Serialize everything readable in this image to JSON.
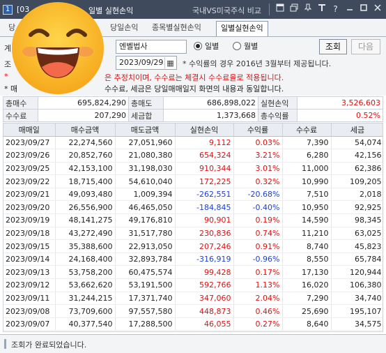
{
  "window": {
    "number": "1",
    "title_prefix": "[03",
    "title_suffix": "일별 실현손익",
    "title_link": "국내VS미국주식 비교",
    "icons": [
      "window-icon",
      "restore-icon",
      "pin-icon",
      "font-icon",
      "help-icon",
      "minimize-icon",
      "maximize-icon",
      "close-icon"
    ]
  },
  "tabs": [
    {
      "label": "당"
    },
    {
      "label": "당일손익"
    },
    {
      "label": "종목별실현손익"
    },
    {
      "label": "일별실현손익",
      "active": true
    }
  ],
  "controls": {
    "account_prefix": "계",
    "account_name": "엔벨법사",
    "query_prefix": "조",
    "date": "2023/09/29",
    "return_note": "* 수익률의 경우 2016년 3월부터 제공됩니다.",
    "radio_daily": "일별",
    "radio_monthly": "월별",
    "btn_query": "조회",
    "btn_next": "다음",
    "red_note_prefix": "*",
    "red_note": "은 추정치이며, 수수료는 체결시 수수료율로 적용됩니다.",
    "black_note_prefix": "* 매",
    "black_note": "수수료, 세금은 당일매매일지 화면의 내용과 동일합니다."
  },
  "summary": {
    "row1": [
      {
        "label": "총매수",
        "value": "695,824,290"
      },
      {
        "label": "총매도",
        "value": "686,898,022"
      },
      {
        "label": "실현손익",
        "value": "3,526,603",
        "color": "#e01010"
      }
    ],
    "row2": [
      {
        "label": "수수료",
        "value": "207,290"
      },
      {
        "label": "세금합",
        "value": "1,373,668"
      },
      {
        "label": "총수익률",
        "value": "0.52%",
        "color": "#e01010"
      }
    ]
  },
  "table": {
    "headers": [
      "매매일",
      "매수금액",
      "매도금액",
      "실현손익",
      "수익률",
      "수수료",
      "세금"
    ],
    "rows": [
      [
        "2023/09/27",
        "22,274,560",
        "27,051,960",
        "9,112",
        "0.03%",
        "7,390",
        "54,074"
      ],
      [
        "2023/09/26",
        "20,852,760",
        "21,080,380",
        "654,324",
        "3.21%",
        "6,280",
        "42,156"
      ],
      [
        "2023/09/25",
        "42,153,100",
        "31,198,030",
        "910,344",
        "3.01%",
        "11,000",
        "62,386"
      ],
      [
        "2023/09/22",
        "18,715,400",
        "54,610,040",
        "172,225",
        "0.32%",
        "10,990",
        "109,205"
      ],
      [
        "2023/09/21",
        "49,093,480",
        "1,009,394",
        "-262,551",
        "-20.68%",
        "7,510",
        "2,018"
      ],
      [
        "2023/09/20",
        "26,556,900",
        "46,465,050",
        "-184,845",
        "-0.40%",
        "10,950",
        "92,925"
      ],
      [
        "2023/09/19",
        "48,141,275",
        "49,176,810",
        "90,901",
        "0.19%",
        "14,590",
        "98,345"
      ],
      [
        "2023/09/18",
        "43,272,490",
        "31,517,780",
        "230,836",
        "0.74%",
        "11,210",
        "63,025"
      ],
      [
        "2023/09/15",
        "35,388,600",
        "22,913,050",
        "207,246",
        "0.91%",
        "8,740",
        "45,823"
      ],
      [
        "2023/09/14",
        "24,168,400",
        "32,893,784",
        "-316,919",
        "-0.96%",
        "8,550",
        "65,784"
      ],
      [
        "2023/09/13",
        "53,758,200",
        "60,475,574",
        "99,428",
        "0.17%",
        "17,130",
        "120,944"
      ],
      [
        "2023/09/12",
        "53,662,620",
        "53,191,500",
        "592,766",
        "1.13%",
        "16,020",
        "106,380"
      ],
      [
        "2023/09/11",
        "31,244,215",
        "17,371,740",
        "347,060",
        "2.04%",
        "7,290",
        "34,740"
      ],
      [
        "2023/09/08",
        "73,709,600",
        "97,557,580",
        "448,873",
        "0.46%",
        "25,690",
        "195,107"
      ],
      [
        "2023/09/07",
        "40,377,540",
        "17,288,500",
        "46,055",
        "0.27%",
        "8,640",
        "34,575"
      ]
    ]
  },
  "status": {
    "message": "조회가 완료되었습니다."
  },
  "colors": {
    "positive": "#e01010",
    "negative": "#1b3fd8",
    "titlebar": "#3f4a5c",
    "emoji_face": "#f6b41c"
  },
  "overlay": {
    "icon": "smiling-face-emoji-icon"
  }
}
